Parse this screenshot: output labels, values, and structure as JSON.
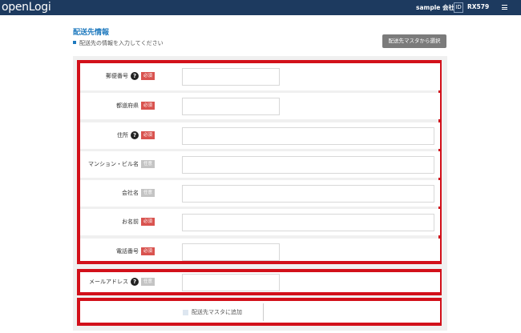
{
  "header": {
    "logo": "openLogi",
    "user": "sample 会社",
    "id_label": "ID",
    "user_id": "RX579"
  },
  "page": {
    "title": "配送先情報",
    "subtitle": "配送先の情報を入力してください",
    "master_select_button": "配送先マスタから選択"
  },
  "badges": {
    "required": "必須",
    "optional": "任意"
  },
  "fields": [
    {
      "label": "郵便番号",
      "help": true,
      "required": true,
      "value": ""
    },
    {
      "label": "都道府県",
      "help": false,
      "required": true,
      "value": ""
    },
    {
      "label": "住所",
      "help": true,
      "required": true,
      "value": ""
    },
    {
      "label": "マンション・ビル名",
      "help": false,
      "required": false,
      "value": ""
    },
    {
      "label": "会社名",
      "help": false,
      "required": false,
      "value": ""
    },
    {
      "label": "お名前",
      "help": false,
      "required": true,
      "value": ""
    },
    {
      "label": "電話番号",
      "help": false,
      "required": true,
      "value": ""
    },
    {
      "label": "メールアドレス",
      "help": true,
      "required": false,
      "value": ""
    }
  ],
  "save_to_master": {
    "label": "配送先マスタに追加",
    "checked": false
  },
  "colors": {
    "header": "#1d3a5f",
    "accent": "#1e79be",
    "required": "#d9534f",
    "highlight": "#d2101a"
  }
}
